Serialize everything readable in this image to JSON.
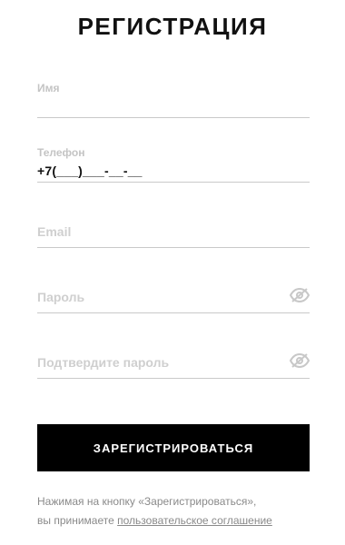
{
  "title": "РЕГИСТРАЦИЯ",
  "form": {
    "name": {
      "label": "Имя"
    },
    "phone": {
      "label": "Телефон",
      "value": "+7(___)___-__-__"
    },
    "email": {
      "placeholder": "Email"
    },
    "password": {
      "placeholder": "Пароль",
      "icon": "eye-off-icon"
    },
    "confirm": {
      "placeholder": "Подтвердите пароль",
      "icon": "eye-off-icon"
    }
  },
  "submit_label": "ЗАРЕГИСТРИРОВАТЬСЯ",
  "agreement": {
    "line1": "Нажимая на кнопку «Зарегистрироваться»,",
    "line2_prefix": "вы принимаете",
    "link": "пользовательское соглашение"
  },
  "colors": {
    "button_bg": "#000000",
    "label_gray": "#d0d0d0",
    "divider": "#c9c9c9"
  }
}
